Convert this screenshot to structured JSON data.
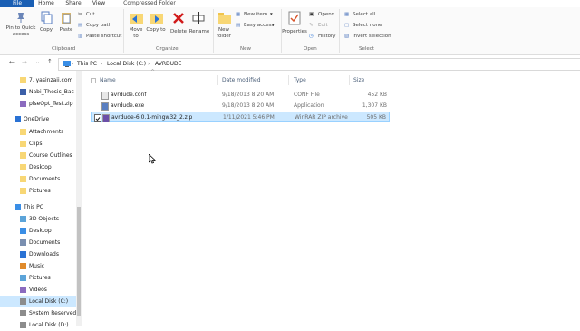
{
  "tabs": {
    "file": "File",
    "home": "Home",
    "share": "Share",
    "view": "View",
    "context": "Compressed Folder Tools"
  },
  "ribbon": {
    "pin_quick_access": "Pin to Quick access",
    "copy": "Copy",
    "paste": "Paste",
    "cut": "Cut",
    "copy_path": "Copy path",
    "paste_shortcut": "Paste shortcut",
    "clipboard_label": "Clipboard",
    "move_to": "Move to",
    "copy_to": "Copy to",
    "delete": "Delete",
    "rename": "Rename",
    "organize_label": "Organize",
    "new_folder": "New folder",
    "new_item": "New item",
    "easy_access": "Easy access",
    "new_label": "New",
    "properties": "Properties",
    "open": "Open",
    "edit": "Edit",
    "history": "History",
    "open_label": "Open",
    "select_all": "Select all",
    "select_none": "Select none",
    "invert_selection": "Invert selection",
    "select_label": "Select"
  },
  "address": {
    "this_pc": "This PC",
    "local_disk": "Local Disk (C:)",
    "folder": "AVRDUDE"
  },
  "nav": {
    "items": [
      {
        "label": "7. yasinzaii.com",
        "icon": "folder-icon"
      },
      {
        "label": "Nabi_Thesis_Bac",
        "icon": "file-icon"
      },
      {
        "label": "plseOpt_Test.zip",
        "icon": "zip-icon"
      },
      {
        "label": "OneDrive",
        "icon": "cloud-icon"
      },
      {
        "label": "Attachments",
        "icon": "folder-icon"
      },
      {
        "label": "Clips",
        "icon": "folder-icon"
      },
      {
        "label": "Course Outlines",
        "icon": "folder-icon"
      },
      {
        "label": "Desktop",
        "icon": "folder-icon"
      },
      {
        "label": "Documents",
        "icon": "folder-icon"
      },
      {
        "label": "Pictures",
        "icon": "folder-icon"
      },
      {
        "label": "This PC",
        "icon": "pc-icon"
      },
      {
        "label": "3D Objects",
        "icon": "cube-icon"
      },
      {
        "label": "Desktop",
        "icon": "desktop-icon"
      },
      {
        "label": "Documents",
        "icon": "documents-icon"
      },
      {
        "label": "Downloads",
        "icon": "download-icon"
      },
      {
        "label": "Music",
        "icon": "music-icon"
      },
      {
        "label": "Pictures",
        "icon": "pictures-icon"
      },
      {
        "label": "Videos",
        "icon": "videos-icon"
      },
      {
        "label": "Local Disk (C:)",
        "icon": "drive-icon"
      },
      {
        "label": "System Reserved",
        "icon": "drive-icon"
      },
      {
        "label": "Local Disk (D:)",
        "icon": "drive-icon"
      }
    ]
  },
  "columns": {
    "name": "Name",
    "date": "Date modified",
    "type": "Type",
    "size": "Size"
  },
  "files": [
    {
      "name": "avrdude.conf",
      "date": "9/18/2013 8:20 AM",
      "type": "CONF File",
      "size": "452 KB"
    },
    {
      "name": "avrdude.exe",
      "date": "9/18/2013 8:20 AM",
      "type": "Application",
      "size": "1,307 KB"
    },
    {
      "name": "avrdude-6.0.1-mingw32_2.zip",
      "date": "1/11/2021 5:46 PM",
      "type": "WinRAR ZIP archive",
      "size": "505 KB"
    }
  ],
  "colors": {
    "accent": "#1a5fb4",
    "selection": "#cce8ff",
    "selection_border": "#99d1ff"
  }
}
